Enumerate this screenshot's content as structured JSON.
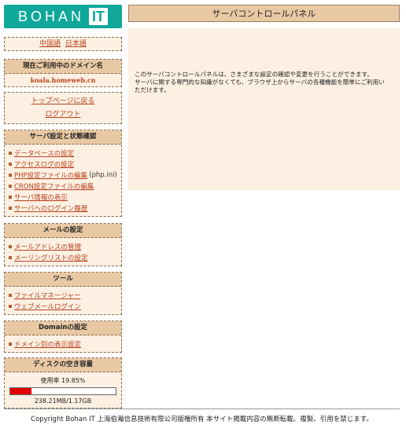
{
  "logo": {
    "word": "BOHAN",
    "it": "IT"
  },
  "header": {
    "title": "サーバコントロールパネル"
  },
  "main": {
    "line1": "このサーバコントロールパネルは、さまざまな設定の確認や変更を行うことができます。",
    "line2": "サーバに関する専門的な知識がなくても、ブラウザ上からサーバの各種機能を簡単にご利用い",
    "line3": "ただけます。"
  },
  "language": {
    "chinese": "中国語",
    "japanese": "日本語"
  },
  "domain_box": {
    "title": "現在ご利用中のドメイン名",
    "domain": "koala.homeweb.cn"
  },
  "nav_box": {
    "top": "トップページに戻る",
    "logout": "ログアウト"
  },
  "server_box": {
    "title": "サーバ設定と状態確認",
    "items": [
      {
        "label": "データベースの設定"
      },
      {
        "label": "アクセスログの設定"
      },
      {
        "label": "PHP設定ファイルの編集",
        "suffix": "(php.ini)"
      },
      {
        "label": "CRON設定ファイルの編集"
      },
      {
        "label": "サーバ情報の表示"
      },
      {
        "label": "サーバへのログイン履歴"
      }
    ]
  },
  "mail_box": {
    "title": "メールの設定",
    "items": [
      {
        "label": "メールアドレスの管理"
      },
      {
        "label": "メーリングリストの設定"
      }
    ]
  },
  "tools_box": {
    "title": "ツール",
    "items": [
      {
        "label": "ファイルマネージャー"
      },
      {
        "label": "ウェブメールログイン"
      }
    ]
  },
  "domain_settings_box": {
    "title": "Domainの設定",
    "items": [
      {
        "label": "ドメイン別の表示設定"
      }
    ]
  },
  "disk_box": {
    "title": "ディスクの空き容量",
    "usage_label": "使用率 19.85%",
    "usage_fraction": 0.1985,
    "capacity": "238.21MB/1.17GB",
    "bar_color": "#e00000"
  },
  "footer": {
    "copyright": "Copyright Bohan IT 上海伯瀚信息技術有限公司版権所有 本サイト掲載内容の無断転載、複製、引用を禁じます。"
  },
  "colors": {
    "logo_bg": "#0fa89a",
    "header_bg": "#e9c9a4",
    "panel_bg": "#fdf0e3",
    "link": "#b8431c"
  }
}
